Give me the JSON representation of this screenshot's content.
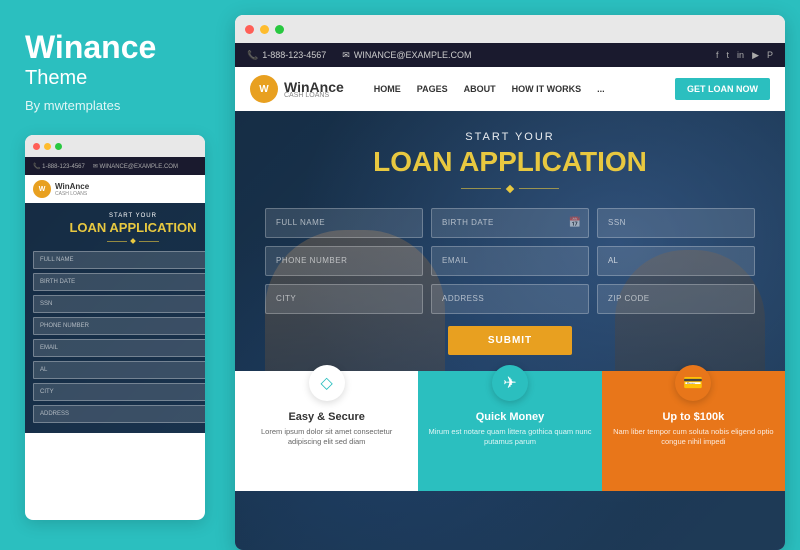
{
  "left": {
    "title": "Winance",
    "subtitle": "Theme",
    "author": "By mwtemplates",
    "dots": [
      "red",
      "yellow",
      "green"
    ]
  },
  "right": {
    "dots": [
      "red",
      "yellow",
      "green"
    ]
  },
  "site": {
    "topbar": {
      "phone": "1-888-123-4567",
      "email": "WINANCE@EXAMPLE.COM",
      "phone_icon": "📞",
      "email_icon": "✉"
    },
    "navbar": {
      "logo_text": "WinAnce",
      "logo_sub": "CASH LOANS",
      "logo_letter": "W",
      "nav_items": [
        "HOME",
        "PAGES",
        "ABOUT",
        "HOW IT WORKS",
        "..."
      ],
      "cta": "GET LOAN NOW"
    },
    "hero": {
      "start_your": "START YOUR",
      "title": "LOAN APPLICATION",
      "form": {
        "full_name": "FULL NAME",
        "birth_date": "BIRTH DATE",
        "ssn": "SSN",
        "phone_number": "PHONE NUMBER",
        "email": "EMAIL",
        "state": "AL",
        "city": "CITY",
        "address": "ADDRESS",
        "zip_code": "ZIP CODE",
        "submit": "SUBMIT"
      }
    },
    "features": [
      {
        "icon": "◇",
        "title": "Easy & Secure",
        "text": "Lorem ipsum dolor sit amet consectetur adipiscing elit sed diam",
        "style": "white"
      },
      {
        "icon": "✈",
        "title": "Quick Money",
        "text": "Mirum est notare quam littera gothica quam nunc putamus parum",
        "style": "teal"
      },
      {
        "icon": "💳",
        "title": "Up to $100k",
        "text": "Nam liber tempor cum soluta nobis eligend optio congue nihil impedi",
        "style": "orange"
      }
    ]
  }
}
